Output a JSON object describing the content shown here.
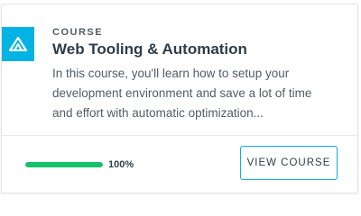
{
  "card": {
    "eyebrow": "COURSE",
    "title": "Web Tooling & Automation",
    "description": "In this course, you'll learn how to setup your development environment and save a lot of time and effort with automatic optimization...",
    "progress": {
      "percent": 100,
      "label": "100%"
    },
    "button_label": "VIEW COURSE",
    "logo_icon": "udacity-logo-icon"
  },
  "colors": {
    "badge": "#02b3e4",
    "progress_fill": "#15c26b",
    "progress_track": "#dbe2e8",
    "button_border": "#02b3e4"
  }
}
